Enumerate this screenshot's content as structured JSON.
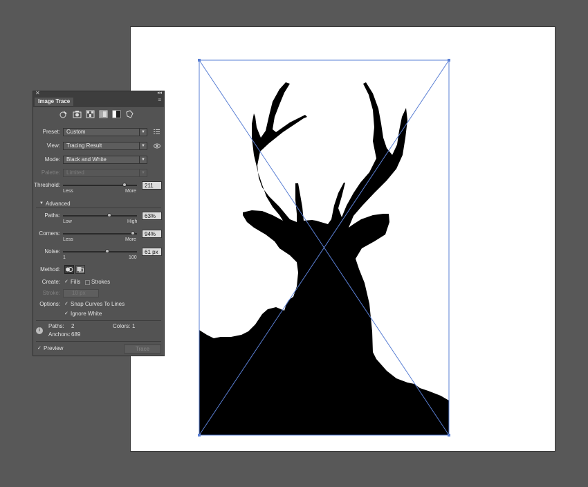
{
  "panel": {
    "title": "Image Trace",
    "close_glyph": "✕",
    "collapse_glyph": "◂◂",
    "menu_glyph": "≡",
    "preset": {
      "label": "Preset:",
      "value": "Custom"
    },
    "view": {
      "label": "View:",
      "value": "Tracing Result"
    },
    "mode": {
      "label": "Mode:",
      "value": "Black and White"
    },
    "palette": {
      "label": "Palette:",
      "value": "Limited"
    },
    "threshold": {
      "label": "Threshold:",
      "value": "211",
      "min_label": "Less",
      "max_label": "More",
      "level": 0.83
    },
    "advanced": {
      "label": "Advanced"
    },
    "paths": {
      "label": "Paths:",
      "value": "63%",
      "min_label": "Low",
      "max_label": "High",
      "level": 0.63
    },
    "corners": {
      "label": "Corners:",
      "value": "94%",
      "min_label": "Less",
      "max_label": "More",
      "level": 0.94
    },
    "noise": {
      "label": "Noise:",
      "value": "61 px",
      "min_label": "1",
      "max_label": "100",
      "level": 0.6
    },
    "method": {
      "label": "Method:"
    },
    "create": {
      "label": "Create:",
      "fills_label": "Fills",
      "fills_checked": true,
      "strokes_label": "Strokes",
      "strokes_checked": false
    },
    "stroke": {
      "label": "Stroke:",
      "value": "10 px"
    },
    "options": {
      "label": "Options:",
      "snap_label": "Snap Curves To Lines",
      "snap_checked": true,
      "ignore_label": "Ignore White",
      "ignore_checked": true
    },
    "stats": {
      "paths_label": "Paths:",
      "paths_value": "2",
      "colors_label": "Colors:",
      "colors_value": "1",
      "anchors_label": "Anchors:",
      "anchors_value": "689"
    },
    "preview": {
      "label": "Preview",
      "checked": true
    },
    "trace_label": "Trace"
  },
  "colors": {
    "bounding_box": "#5a7fd4",
    "panel_bg": "#535353",
    "canvas_bg": "#585858"
  }
}
